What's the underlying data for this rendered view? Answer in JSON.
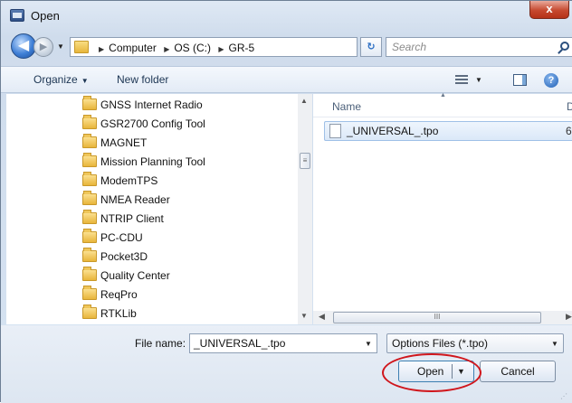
{
  "window": {
    "title": "Open",
    "close_glyph": "x"
  },
  "nav": {
    "back_glyph": "◀",
    "forward_glyph": "▶",
    "breadcrumbs": [
      "Computer",
      "OS (C:)",
      "GR-5"
    ],
    "search_placeholder": "Search"
  },
  "toolbar": {
    "organize_label": "Organize",
    "new_folder_label": "New folder",
    "help_glyph": "?"
  },
  "tree": {
    "items": [
      "GNSS Internet Radio",
      "GSR2700 Config Tool",
      "MAGNET",
      "Mission Planning Tool",
      "ModemTPS",
      "NMEA Reader",
      "NTRIP Client",
      "PC-CDU",
      "Pocket3D",
      "Quality Center",
      "ReqPro",
      "RTKLib"
    ]
  },
  "files": {
    "columns": {
      "name": "Name",
      "next_truncated": "D"
    },
    "rows": [
      {
        "name": "_UNIVERSAL_.tpo",
        "next_truncated": "6"
      }
    ]
  },
  "bottom": {
    "file_name_label": "File name:",
    "file_name_value": "_UNIVERSAL_.tpo",
    "file_type_value": "Options Files (*.tpo)",
    "open_label": "Open",
    "cancel_label": "Cancel"
  },
  "scroll": {
    "hthumb_glyph": "III",
    "vthumb_glyph": "≡"
  },
  "colors": {
    "accent": "#3c7fb1",
    "highlight_ring": "#d0161c",
    "title_close": "#c6492f"
  }
}
